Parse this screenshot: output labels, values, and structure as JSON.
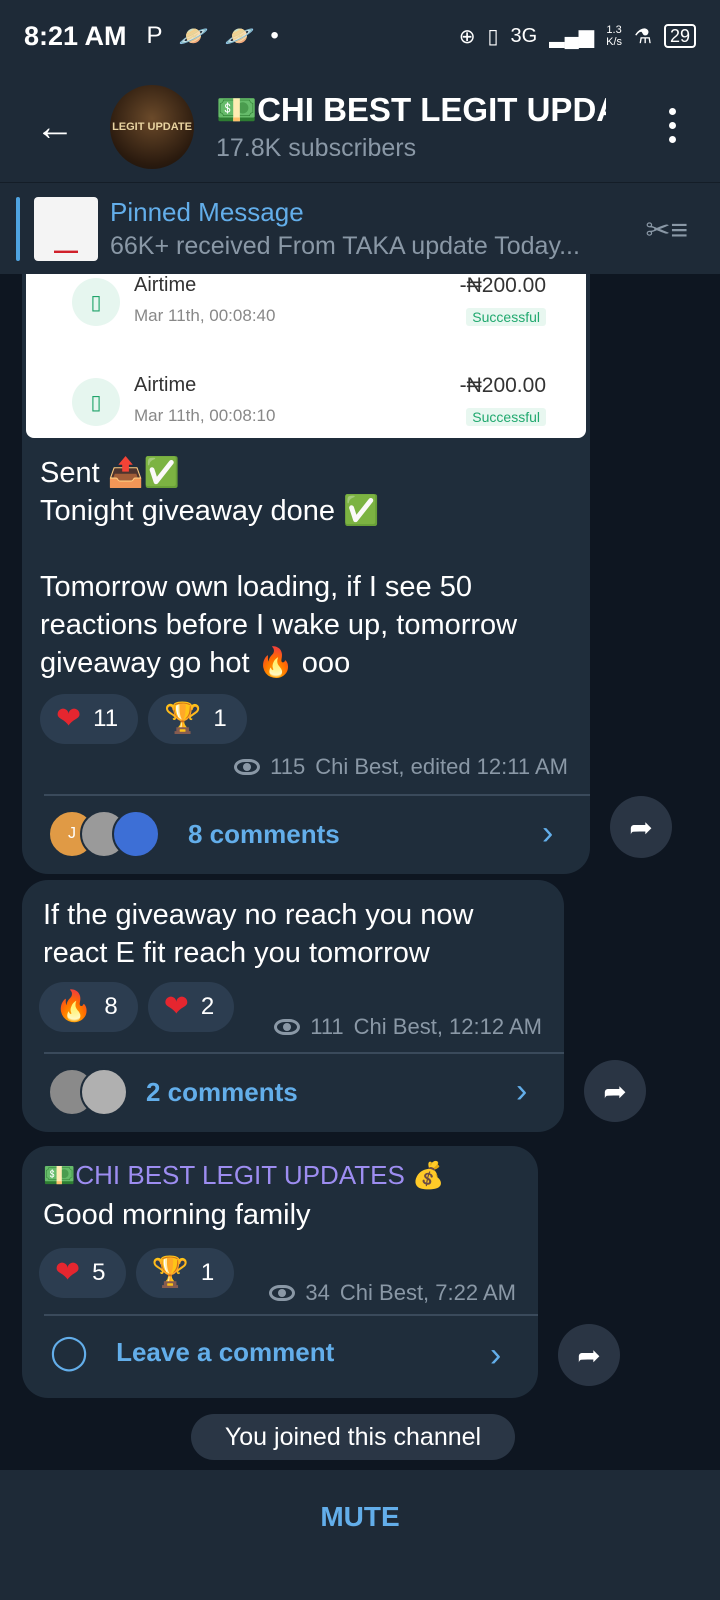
{
  "status_bar": {
    "time": "8:21 AM",
    "net_speed_value": "1.3",
    "net_speed_unit": "K/s",
    "network": "3G",
    "battery": "29"
  },
  "header": {
    "title": "💵CHI BEST LEGIT UPDA",
    "subscribers": "17.8K subscribers",
    "avatar_text": "LEGIT UPDATE"
  },
  "pinned": {
    "title": "Pinned Message",
    "preview": "66K+ received From TAKA update Today..."
  },
  "receipt_rows": [
    {
      "title": "Airtime",
      "date": "Mar 11th, 00:08:40",
      "amount": "-₦200.00",
      "status": "Successful"
    },
    {
      "title": "Airtime",
      "date": "Mar 11th, 00:08:10",
      "amount": "-₦200.00",
      "status": "Successful"
    }
  ],
  "messages": [
    {
      "text": "Sent 📤✅\nTonight giveaway done ✅\n\nTomorrow own loading, if I see 50 reactions before I wake up, tomorrow giveaway go hot 🔥 ooo",
      "reactions": [
        {
          "emoji": "❤",
          "count": "11"
        },
        {
          "emoji": "🏆",
          "count": "1"
        }
      ],
      "views": "115",
      "meta": "Chi Best, edited 12:11 AM",
      "comments_label": "8 comments",
      "comment_avatar_initial": "J"
    },
    {
      "text": "If the giveaway no reach you now react E fit reach you tomorrow",
      "reactions": [
        {
          "emoji": "🔥",
          "count": "8"
        },
        {
          "emoji": "❤",
          "count": "2"
        }
      ],
      "views": "111",
      "meta": "Chi Best, 12:12 AM",
      "comments_label": "2 comments"
    },
    {
      "sender": "💵CHI BEST LEGIT UPDATES 💰",
      "text": "Good morning family",
      "reactions": [
        {
          "emoji": "❤",
          "count": "5"
        },
        {
          "emoji": "🏆",
          "count": "1"
        }
      ],
      "views": "34",
      "meta": "Chi Best, 7:22 AM",
      "comments_label": "Leave a comment"
    }
  ],
  "service_message": "You joined this channel",
  "bottom": {
    "mute_label": "MUTE"
  },
  "colors": {
    "accent": "#63aeea",
    "bubble": "#1f2d3b",
    "background": "#0e1621",
    "header": "#1e2a37"
  }
}
